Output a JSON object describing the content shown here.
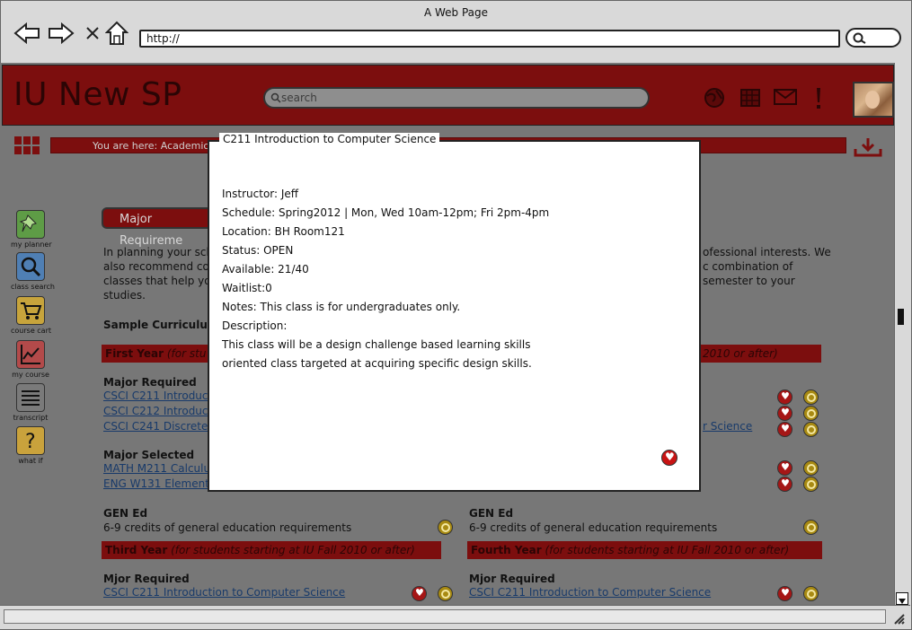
{
  "window": {
    "title": "A Web Page",
    "url": "http://"
  },
  "site": {
    "title": "IU New SP",
    "search_placeholder": "search"
  },
  "breadcrumb": "You are here: Academic",
  "sidebar": [
    {
      "label": "my planner",
      "icon": "pushpin-icon",
      "color": "#5e9c46"
    },
    {
      "label": "class search",
      "icon": "magnifier-icon",
      "color": "#4f7fb4"
    },
    {
      "label": "course cart",
      "icon": "cart-icon",
      "color": "#c7a43c"
    },
    {
      "label": "my course",
      "icon": "chart-icon",
      "color": "#b34a4a"
    },
    {
      "label": "transcript",
      "icon": "list-icon",
      "color": "#7a7a7a"
    },
    {
      "label": "what if",
      "icon": "question-icon",
      "color": "#c9a23c"
    }
  ],
  "main": {
    "major_button": "Major Requireme",
    "intro_lines": [
      "In planning your sche",
      "also recommend cor",
      "classes that help you",
      "studies."
    ],
    "intro_right_lines": [
      "ofessional interests. We",
      "c combination of",
      "semester to your"
    ],
    "sample_curriculum": "Sample Curriculum",
    "first_year_bar": {
      "title": "First Year",
      "note": "(for stu"
    },
    "second_year_bar_note": "2010 or after)",
    "major_required": "Major Required",
    "left_links": [
      "CSCI C211 Introduc",
      "CSCI C212 Introduc",
      "CSCI C241 Discrete"
    ],
    "right_link_fragment": "r Science",
    "major_selected": "Major Selected",
    "selected_links": [
      "MATH M211 Calculus",
      "ENG W131 Elemente"
    ],
    "gen_ed": "GEN Ed",
    "gen_ed_desc": "6-9 credits of general education requirements",
    "third_year_bar": {
      "title": "Third Year",
      "note": "(for students starting at IU Fall 2010 or after)"
    },
    "fourth_year_bar": {
      "title": "Fourth Year",
      "note": "(for students starting at IU Fall 2010 or after)"
    },
    "mjor_required": "Mjor Required",
    "bottom_link": "CSCI C211 Introduction to Computer Science"
  },
  "modal": {
    "title": "C211 Introduction to Computer Science",
    "instructor": "Instructor: Jeff",
    "schedule": "Schedule: Spring2012 | Mon, Wed 10am-12pm; Fri 2pm-4pm",
    "location": "Location: BH Room121",
    "status": "Status: OPEN",
    "available": "Available: 21/40",
    "waitlist": "Waitlist:0",
    "notes": "Notes: This class is for undergraduates only.",
    "description_label": "Description:",
    "description_1": "This class will be a design challenge based learning skills",
    "description_2": "oriented class targeted at acquiring specific design skills."
  },
  "colors": {
    "brand_red": "#7c0e0e",
    "overlay_gray": "#777777",
    "heart_red": "#c81414",
    "magnifier_gold": "#a88a12"
  }
}
